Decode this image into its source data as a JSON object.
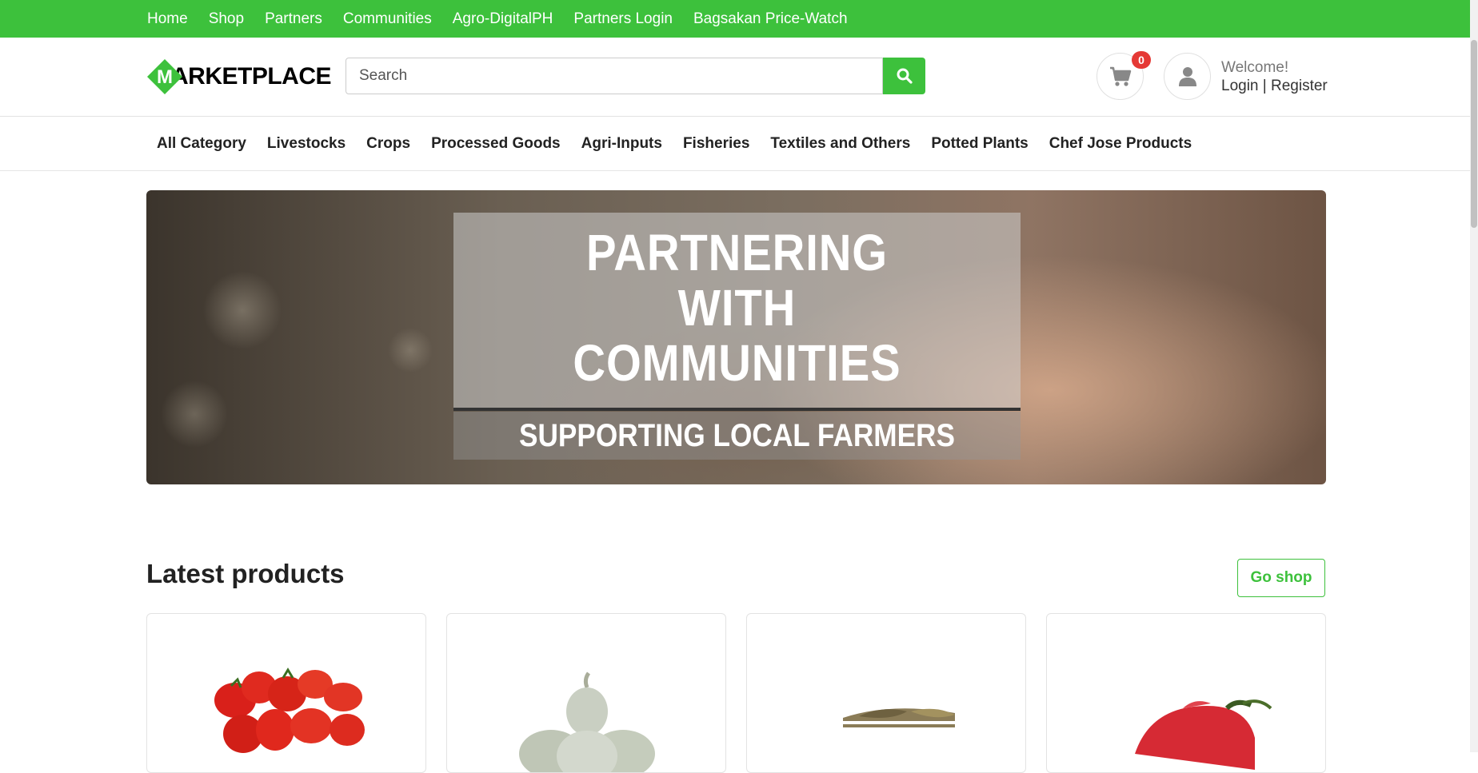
{
  "topnav": {
    "items": [
      "Home",
      "Shop",
      "Partners",
      "Communities",
      "Agro-DigitalPH",
      "Partners Login",
      "Bagsakan Price-Watch"
    ]
  },
  "header": {
    "logo_letter": "M",
    "logo_text": "ARKETPLACE",
    "search_placeholder": "Search",
    "cart_count": "0",
    "welcome": "Welcome!",
    "login": "Login",
    "separator": " | ",
    "register": "Register"
  },
  "categories": [
    "All Category",
    "Livestocks",
    "Crops",
    "Processed Goods",
    "Agri-Inputs",
    "Fisheries",
    "Textiles and Others",
    "Potted Plants",
    "Chef Jose Products"
  ],
  "hero": {
    "line1": "PARTNERING",
    "line2": "WITH",
    "line3": "COMMUNITIES",
    "subline": "SUPPORTING LOCAL FARMERS"
  },
  "latest": {
    "title": "Latest products",
    "go_shop": "Go shop",
    "products": [
      {
        "image": "tomatoes-image"
      },
      {
        "image": "garlic-image"
      },
      {
        "image": "dried-fish-image"
      },
      {
        "image": "red-pepper-image"
      }
    ]
  },
  "colors": {
    "brand_green": "#3dc13c",
    "badge_red": "#e53935"
  }
}
